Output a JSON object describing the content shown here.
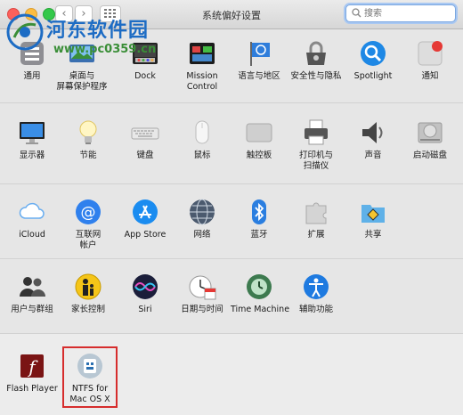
{
  "window": {
    "title": "系统偏好设置"
  },
  "search": {
    "placeholder": "搜索"
  },
  "watermark": {
    "brand": "河东软件园",
    "url": "www.pc0359.cn"
  },
  "sections": {
    "personal": [
      {
        "label": "通用",
        "icon": "general-icon"
      },
      {
        "label": "桌面与",
        "label2": "屏幕保护程序",
        "icon": "desktop-screensaver-icon"
      },
      {
        "label": "Dock",
        "icon": "dock-icon"
      },
      {
        "label": "Mission",
        "label2": "Control",
        "icon": "mission-control-icon"
      },
      {
        "label": "语言与地区",
        "icon": "language-region-icon"
      },
      {
        "label": "安全性与隐私",
        "icon": "security-privacy-icon"
      },
      {
        "label": "Spotlight",
        "icon": "spotlight-icon"
      },
      {
        "label": "通知",
        "icon": "notifications-icon"
      }
    ],
    "hardware": [
      {
        "label": "显示器",
        "icon": "displays-icon"
      },
      {
        "label": "节能",
        "icon": "energy-saver-icon"
      },
      {
        "label": "键盘",
        "icon": "keyboard-icon"
      },
      {
        "label": "鼠标",
        "icon": "mouse-icon"
      },
      {
        "label": "触控板",
        "icon": "trackpad-icon"
      },
      {
        "label": "打印机与",
        "label2": "扫描仪",
        "icon": "printer-scanner-icon"
      },
      {
        "label": "声音",
        "icon": "sound-icon"
      },
      {
        "label": "启动磁盘",
        "icon": "startup-disk-icon"
      }
    ],
    "internet": [
      {
        "label": "iCloud",
        "icon": "icloud-icon"
      },
      {
        "label": "互联网",
        "label2": "帐户",
        "icon": "internet-accounts-icon"
      },
      {
        "label": "App Store",
        "icon": "app-store-icon"
      },
      {
        "label": "网络",
        "icon": "network-icon"
      },
      {
        "label": "蓝牙",
        "icon": "bluetooth-icon"
      },
      {
        "label": "扩展",
        "icon": "extensions-icon"
      },
      {
        "label": "共享",
        "icon": "sharing-icon"
      }
    ],
    "system": [
      {
        "label": "用户与群组",
        "icon": "users-groups-icon"
      },
      {
        "label": "家长控制",
        "icon": "parental-controls-icon"
      },
      {
        "label": "Siri",
        "icon": "siri-icon"
      },
      {
        "label": "日期与时间",
        "icon": "date-time-icon"
      },
      {
        "label": "Time Machine",
        "icon": "time-machine-icon"
      },
      {
        "label": "辅助功能",
        "icon": "accessibility-icon"
      }
    ],
    "other": [
      {
        "label": "Flash Player",
        "icon": "flash-player-icon"
      },
      {
        "label": "NTFS for",
        "label2": "Mac OS X",
        "icon": "ntfs-icon"
      }
    ]
  },
  "colors": {
    "accent": "#1d6cc4",
    "highlight": "#d62d2d"
  }
}
